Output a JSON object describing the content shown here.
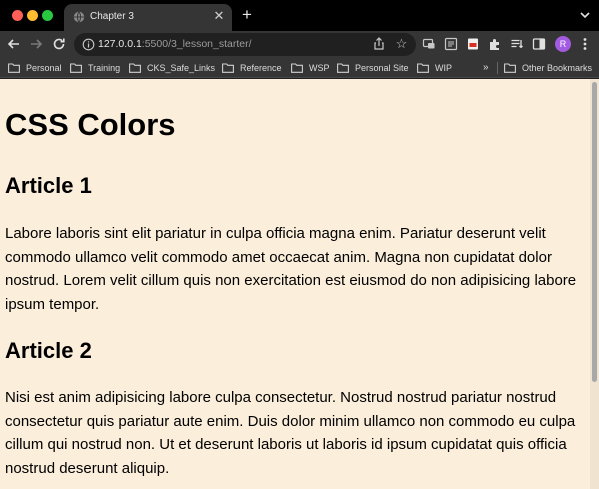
{
  "window": {
    "tab_title": "Chapter 3",
    "new_tab_label": "+"
  },
  "toolbar": {
    "url_host": "127.0.0.1",
    "url_rest": ":5500/3_lesson_starter/",
    "avatar_initial": "R"
  },
  "bookmarks": {
    "items": [
      "Personal",
      "Training",
      "CKS_Safe_Links",
      "Reference",
      "WSP",
      "Personal Site",
      "WIP"
    ],
    "overflow_label": "»",
    "other_label": "Other Bookmarks"
  },
  "page": {
    "heading": "CSS Colors",
    "article1_title": "Article 1",
    "article1_body": "Labore laboris sint elit pariatur in culpa officia magna enim. Pariatur deserunt velit commodo ullamco velit commodo amet occaecat anim. Magna non cupidatat dolor nostrud. Lorem velit cillum quis non exercitation est eiusmod do non adipisicing labore ipsum tempor.",
    "article2_title": "Article 2",
    "article2_body": "Nisi est anim adipisicing labore culpa consectetur. Nostrud nostrud pariatur nostrud consectetur quis pariatur aute enim. Duis dolor minim ullamco non commodo eu culpa cillum qui nostrud non. Ut et deserunt laboris ut laboris id ipsum cupidatat quis officia nostrud deserunt aliquip."
  },
  "colors": {
    "page_background": "#fbeedb",
    "avatar": "#a25be0"
  }
}
